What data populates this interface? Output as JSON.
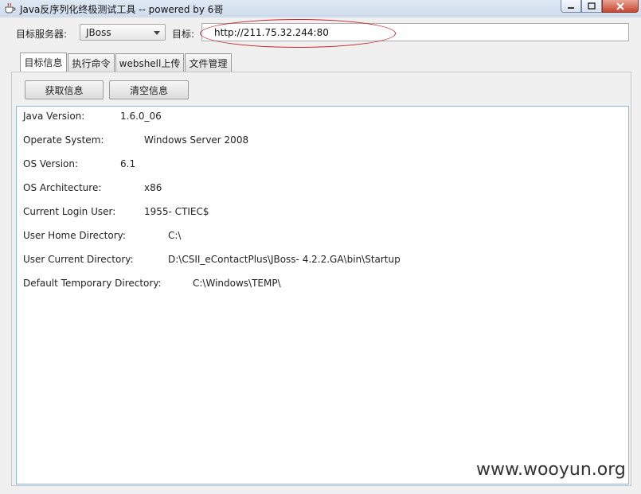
{
  "window": {
    "title": "Java反序列化终极测试工具  -- powered by 6哥"
  },
  "form": {
    "server_label": "目标服务器:",
    "server_value": "JBoss",
    "target_label": "目标:",
    "target_value": "http://211.75.32.244:80"
  },
  "tabs": [
    {
      "label": "目标信息"
    },
    {
      "label": "执行命令"
    },
    {
      "label": "webshell上传"
    },
    {
      "label": "文件管理"
    }
  ],
  "buttons": {
    "get_info": "获取信息",
    "clear_info": "清空信息"
  },
  "output": [
    {
      "key": "Java Version:",
      "value": "1.6.0_06"
    },
    {
      "key": "Operate System:",
      "value": "Windows Server 2008"
    },
    {
      "key": "OS Version:",
      "value": "6.1"
    },
    {
      "key": "OS Architecture:",
      "value": "x86"
    },
    {
      "key": "Current Login User:",
      "value": "1955- CTIEC$"
    },
    {
      "key": "User Home Directory:",
      "value": "C:\\"
    },
    {
      "key": "User Current Directory:",
      "value": "D:\\CSII_eContactPlus\\JBoss- 4.2.2.GA\\bin\\Startup"
    },
    {
      "key": "Default Temporary Directory:",
      "value": "C:\\Windows\\TEMP\\"
    }
  ],
  "watermark": "www.wooyun.org",
  "colors": {
    "annotation_ellipse": "#c8262b",
    "output_border": "#8fb8d6"
  }
}
